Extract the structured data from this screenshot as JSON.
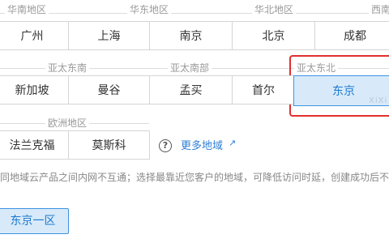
{
  "region_groups": {
    "row1": {
      "labels": [
        "华南地区",
        "华东地区",
        "华北地区",
        "西南"
      ],
      "buttons": [
        "广州",
        "上海",
        "南京",
        "北京",
        "成都"
      ]
    },
    "row2": {
      "labels": [
        "亚太东南",
        "亚太南部",
        "亚太东北"
      ],
      "buttons": [
        "新加坡",
        "曼谷",
        "孟买",
        "首尔",
        "东京"
      ]
    },
    "row3": {
      "labels": [
        "欧洲地区"
      ],
      "buttons": [
        "法兰克福",
        "莫斯科"
      ]
    }
  },
  "selected_region": "东京",
  "watermark": "XiXi",
  "more_regions_link": "更多地域",
  "notice": "同地域云产品之间内网不互通；选择最靠近您客户的地域，可降低访问时延，创建成功后不支",
  "availability_zone": {
    "selected": "东京一区"
  },
  "colors": {
    "accent": "#3d93e1",
    "selected_bg": "#d8eaf9",
    "highlight_border": "#e0302e",
    "link": "#2f7fd6"
  },
  "icons": {
    "help": "question-circle-icon",
    "external": "external-link-icon"
  }
}
